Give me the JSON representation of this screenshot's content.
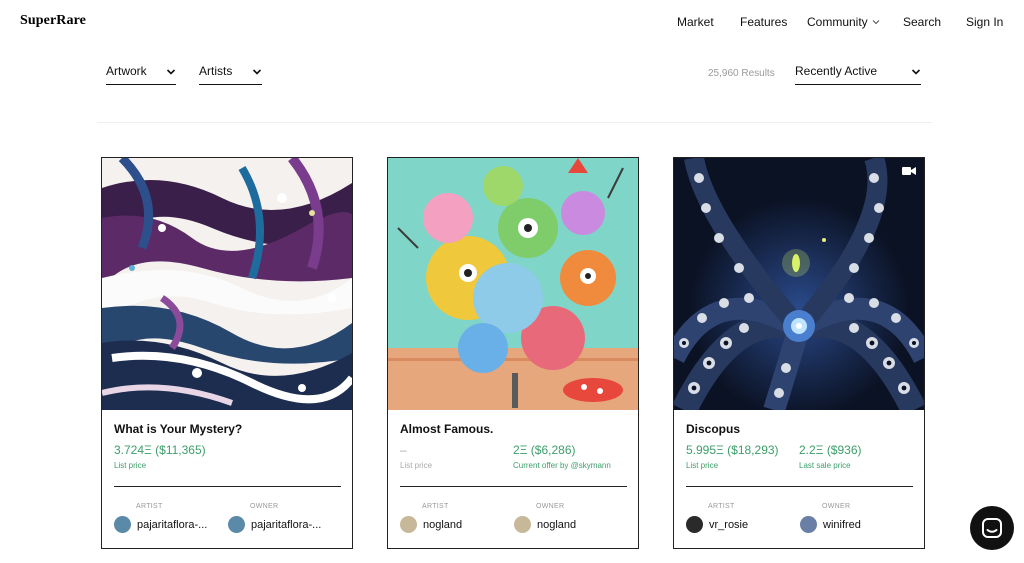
{
  "brand": "SuperRare",
  "nav": {
    "market": "Market",
    "features": "Features",
    "community": "Community",
    "search": "Search",
    "sign_in": "Sign In"
  },
  "filters": {
    "artwork": "Artwork",
    "artists": "Artists",
    "results": "25,960 Results",
    "sort": "Recently Active"
  },
  "cards": [
    {
      "title": "What is Your Mystery?",
      "price": "3.724Ξ ($11,365)",
      "price_label": "List price",
      "artist_role": "ARTIST",
      "artist": "pajaritaflora-...",
      "owner_role": "OWNER",
      "owner": "pajaritaflora-..."
    },
    {
      "title": "Almost Famous.",
      "price": "–",
      "price_label": "List price",
      "offer": "2Ξ ($6,286)",
      "offer_label": "Current offer by @skymann",
      "artist_role": "ARTIST",
      "artist": "nogland",
      "owner_role": "OWNER",
      "owner": "nogland"
    },
    {
      "title": "Discopus",
      "price": "5.995Ξ ($18,293)",
      "price_label": "List price",
      "last_sale": "2.2Ξ ($936)",
      "last_sale_label": "Last sale price",
      "artist_role": "ARTIST",
      "artist": "vr_rosie",
      "owner_role": "OWNER",
      "owner": "winifred"
    }
  ],
  "icons": {
    "video": "video-icon",
    "chat": "chat-icon",
    "chevron": "chevron-down-icon"
  },
  "colors": {
    "price_green": "#3d9e6a",
    "muted": "#9a9a9a",
    "text": "#111111"
  }
}
